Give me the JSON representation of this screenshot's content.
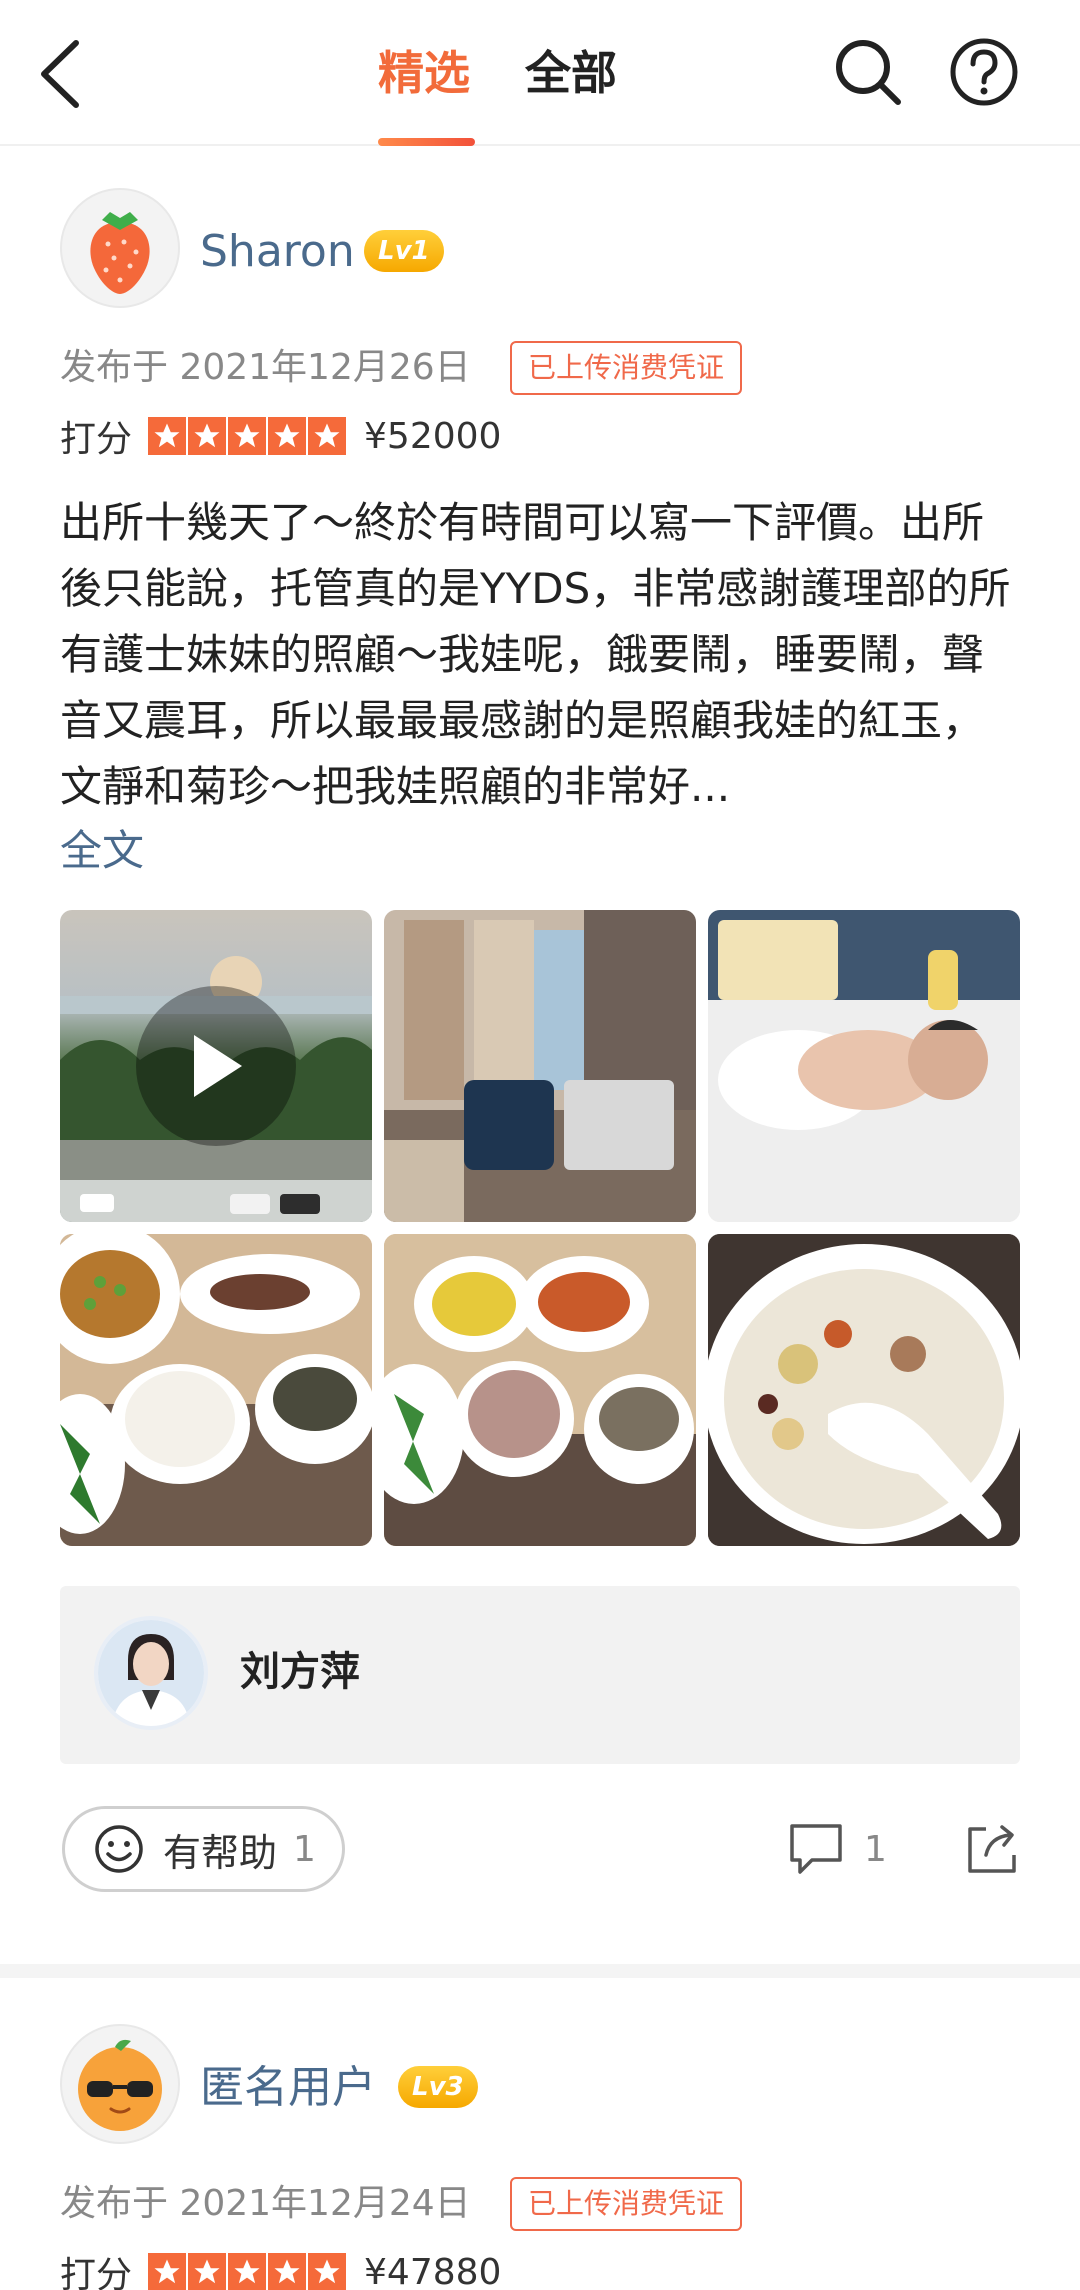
{
  "header": {
    "tab_featured": "精选",
    "tab_all": "全部",
    "accent_color": "#f26b3a"
  },
  "reviews": [
    {
      "username": "Sharon",
      "level": "Lv1",
      "date": "发布于 2021年12月26日",
      "receipt_badge": "已上传消费凭证",
      "rating_label": "打分",
      "stars": 5,
      "price": "¥52000",
      "text": "出所十幾天了～終於有時間可以寫一下評價。出所後只能說，托管真的是YYDS，非常感謝護理部的所有護士妹妹的照顧～我娃呢，餓要鬧，睡要鬧，聲音又震耳，所以最最最感謝的是照顧我娃的紅玉，文靜和菊珍～把我娃照顧的非常好...",
      "full_text_link": "全文",
      "staff_name": "刘方萍",
      "helpful_label": "有帮助",
      "helpful_count": "1",
      "comment_count": "1"
    },
    {
      "username": "匿名用户",
      "level": "Lv3",
      "date": "发布于 2021年12月24日",
      "receipt_badge": "已上传消费凭证",
      "rating_label": "打分",
      "stars": 5,
      "price": "¥47880"
    }
  ]
}
